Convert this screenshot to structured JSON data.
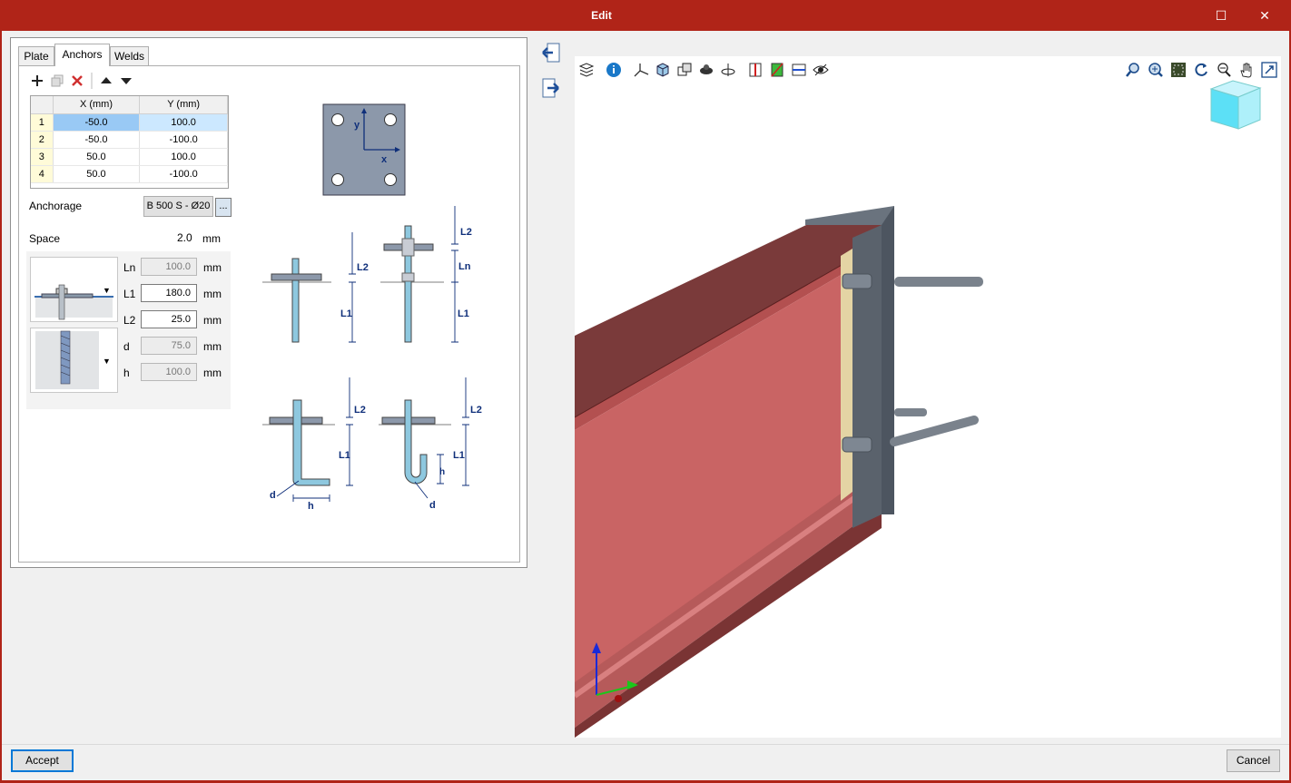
{
  "window": {
    "title": "Edit",
    "maximize_glyph": "☐",
    "close_glyph": "✕"
  },
  "tabs": [
    {
      "label": "Plate"
    },
    {
      "label": "Anchors"
    },
    {
      "label": "Welds"
    }
  ],
  "table": {
    "headers": [
      "X (mm)",
      "Y (mm)"
    ],
    "rows": [
      {
        "n": "1",
        "x": "-50.0",
        "y": "100.0"
      },
      {
        "n": "2",
        "x": "-50.0",
        "y": "-100.0"
      },
      {
        "n": "3",
        "x": "50.0",
        "y": "100.0"
      },
      {
        "n": "4",
        "x": "50.0",
        "y": "-100.0"
      }
    ]
  },
  "anchorage": {
    "label": "Anchorage",
    "value": "B 500 S - Ø20",
    "more": "..."
  },
  "space": {
    "label": "Space",
    "value": "2.0",
    "unit": "mm"
  },
  "params": {
    "ln": {
      "label": "Ln",
      "value": "100.0",
      "unit": "mm"
    },
    "l1": {
      "label": "L1",
      "value": "180.0",
      "unit": "mm"
    },
    "l2": {
      "label": "L2",
      "value": "25.0",
      "unit": "mm"
    },
    "d": {
      "label": "d",
      "value": "75.0",
      "unit": "mm"
    },
    "h": {
      "label": "h",
      "value": "100.0",
      "unit": "mm"
    }
  },
  "diagram_labels": {
    "x": "x",
    "y": "y",
    "L1": "L1",
    "L2": "L2",
    "Ln": "Ln",
    "d": "d",
    "h": "h"
  },
  "buttons": {
    "accept": "Accept",
    "cancel": "Cancel"
  },
  "colors": {
    "title_bar": "#b02418",
    "beam": "#c96464",
    "plate": "#4d5560"
  }
}
